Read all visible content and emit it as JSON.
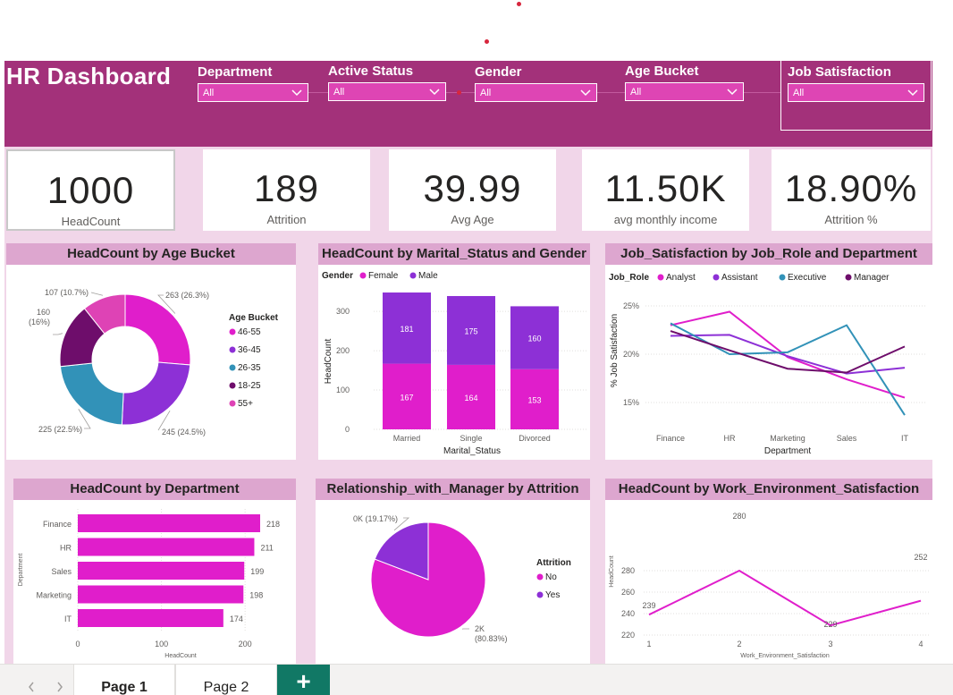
{
  "app": {
    "title": "HR Dashboard",
    "colors": {
      "header": "#a3317a",
      "canvas": "#f1d6e9",
      "card_title_bg": "#dda6cf",
      "slicer_bg": "#de45b4",
      "tab_add": "#117865"
    }
  },
  "slicers": [
    {
      "label": "Department",
      "value": "All"
    },
    {
      "label": "Active Status",
      "value": "All"
    },
    {
      "label": "Gender",
      "value": "All"
    },
    {
      "label": "Age Bucket",
      "value": "All"
    },
    {
      "label": "Job Satisfaction",
      "value": "All"
    }
  ],
  "kpis": [
    {
      "value": "1000",
      "caption": "HeadCount"
    },
    {
      "value": "189",
      "caption": "Attrition"
    },
    {
      "value": "39.99",
      "caption": "Avg Age"
    },
    {
      "value": "11.50K",
      "caption": "avg monthly income"
    },
    {
      "value": "18.90%",
      "caption": "Attrition %"
    }
  ],
  "cards": {
    "age": "HeadCount by Age Bucket",
    "marital": "HeadCount by Marital_Status and Gender",
    "jobsat": "Job_Satisfaction by Job_Role and Department",
    "dept": "HeadCount by Department",
    "manager": "Relationship_with_Manager by Attrition",
    "workenv": "HeadCount by Work_Environment_Satisfaction"
  },
  "tabs": {
    "page1": "Page 1",
    "page2": "Page 2",
    "add": "+"
  },
  "chart_data": [
    {
      "type": "pie",
      "variant": "donut",
      "legend_title": "Age Bucket",
      "categories": [
        "46-55",
        "36-45",
        "26-35",
        "18-25",
        "55+"
      ],
      "values": [
        263,
        245,
        225,
        160,
        107
      ],
      "data_labels": [
        "263 (26.3%)",
        "245 (24.5%)",
        "225 (22.5%)",
        "160 (16%)",
        "107 (10.7%)"
      ],
      "colors": [
        "#e01ecb",
        "#8d30d6",
        "#3292b8",
        "#6e0d6b",
        "#de43b5"
      ]
    },
    {
      "type": "bar",
      "stacked": true,
      "legend_title": "Gender",
      "categories": [
        "Married",
        "Single",
        "Divorced"
      ],
      "series": [
        {
          "name": "Female",
          "values": [
            167,
            164,
            153
          ],
          "color": "#e01ecb"
        },
        {
          "name": "Male",
          "values": [
            181,
            175,
            160
          ],
          "color": "#8d30d6"
        }
      ],
      "xlabel": "Marital_Status",
      "ylabel": "HeadCount",
      "yticks": [
        0,
        100,
        200,
        300
      ],
      "ylim": [
        0,
        360
      ]
    },
    {
      "type": "line",
      "legend_title": "Job_Role",
      "categories": [
        "Finance",
        "HR",
        "Marketing",
        "Sales",
        "IT"
      ],
      "series": [
        {
          "name": "Analyst",
          "values": [
            0.23,
            0.244,
            0.197,
            0.174,
            0.155
          ],
          "color": "#e01ecb"
        },
        {
          "name": "Assistant",
          "values": [
            0.219,
            0.22,
            0.198,
            0.18,
            0.186
          ],
          "color": "#8d30d6"
        },
        {
          "name": "Executive",
          "values": [
            0.232,
            0.2,
            0.202,
            0.23,
            0.137
          ],
          "color": "#3292b8"
        },
        {
          "name": "Manager",
          "values": [
            0.224,
            0.204,
            0.185,
            0.181,
            0.208
          ],
          "color": "#6e0d6b"
        }
      ],
      "xlabel": "Department",
      "ylabel": "% Job Satisfaction",
      "yticks": [
        "15%",
        "20%",
        "25%"
      ],
      "ylim": [
        0.12,
        0.26
      ]
    },
    {
      "type": "bar",
      "orientation": "horizontal",
      "categories": [
        "Finance",
        "HR",
        "Sales",
        "Marketing",
        "IT"
      ],
      "values": [
        218,
        211,
        199,
        198,
        174
      ],
      "color": "#e01ecb",
      "xlabel": "HeadCount",
      "ylabel": "Department",
      "xticks": [
        0,
        100,
        200
      ],
      "xlim": [
        0,
        240
      ]
    },
    {
      "type": "pie",
      "legend_title": "Attrition",
      "categories": [
        "No",
        "Yes"
      ],
      "values": [
        80.83,
        19.17
      ],
      "data_labels": [
        "2K (80.83%)",
        "0K (19.17%)"
      ],
      "colors": [
        "#e01ecb",
        "#8d30d6"
      ]
    },
    {
      "type": "line",
      "categories": [
        "1",
        "2",
        "3",
        "4"
      ],
      "values": [
        239,
        280,
        229,
        252
      ],
      "color": "#e01ecb",
      "xlabel": "Work_Environment_Satisfaction",
      "ylabel": "HeadCount",
      "yticks": [
        220,
        240,
        260,
        280
      ],
      "ylim": [
        218,
        282
      ]
    }
  ]
}
